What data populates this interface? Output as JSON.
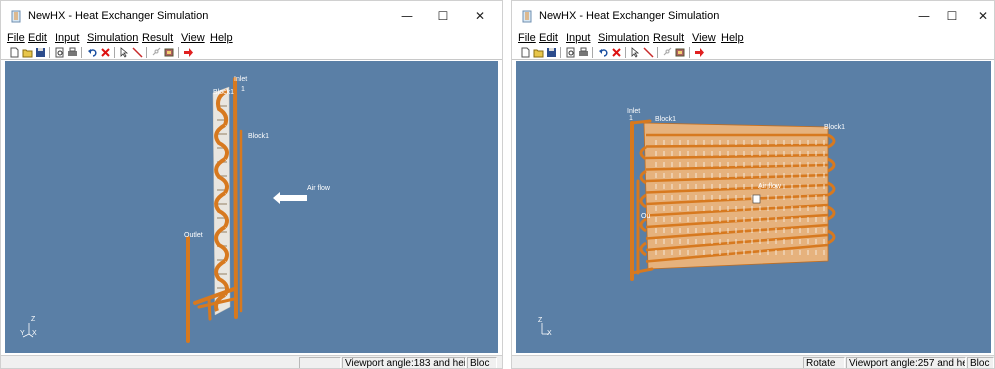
{
  "windows": [
    {
      "title": "NewHX - Heat Exchanger Simulation",
      "menu": [
        "File",
        "Edit",
        "Input",
        "Simulation",
        "Result",
        "View",
        "Help"
      ],
      "viewport_labels": {
        "inlet": "Inlet",
        "inlet_num": "1",
        "block_top": "Block1",
        "block_side": "Block1",
        "air_flow": "Air flow",
        "outlet": "Outlet"
      },
      "axes": {
        "z": "Z",
        "y": "Y",
        "x": "X"
      },
      "status": {
        "cell1": "",
        "cell2": "Viewport angle:183 and heig",
        "cell3": "Bloc"
      }
    },
    {
      "title": "NewHX - Heat Exchanger Simulation",
      "menu": [
        "File",
        "Edit",
        "Input",
        "Simulation",
        "Result",
        "View",
        "Help"
      ],
      "viewport_labels": {
        "inlet": "Inlet",
        "inlet_num": "1",
        "block_top": "Block1",
        "block_side": "Block1",
        "air_flow": "Air flow",
        "outlet": "Ou"
      },
      "axes": {
        "z": "Z",
        "x": "X"
      },
      "status": {
        "cell1": "Rotate",
        "cell2": "Viewport angle:257 and heig",
        "cell3": "Bloc"
      }
    }
  ],
  "window_controls": {
    "minimize": "—",
    "maximize": "☐",
    "close": "✕"
  },
  "colors": {
    "viewport_bg": "#5a7fa6",
    "tube": "#d7791f",
    "fin": "#e9e6e0",
    "arrow": "#ffffff"
  },
  "toolbar_icons": [
    "new-icon",
    "open-icon",
    "save-icon",
    "print-preview-icon",
    "print-icon",
    "undo-icon",
    "delete-icon",
    "select-icon",
    "draw-icon",
    "link-icon",
    "component-icon",
    "run-icon"
  ]
}
